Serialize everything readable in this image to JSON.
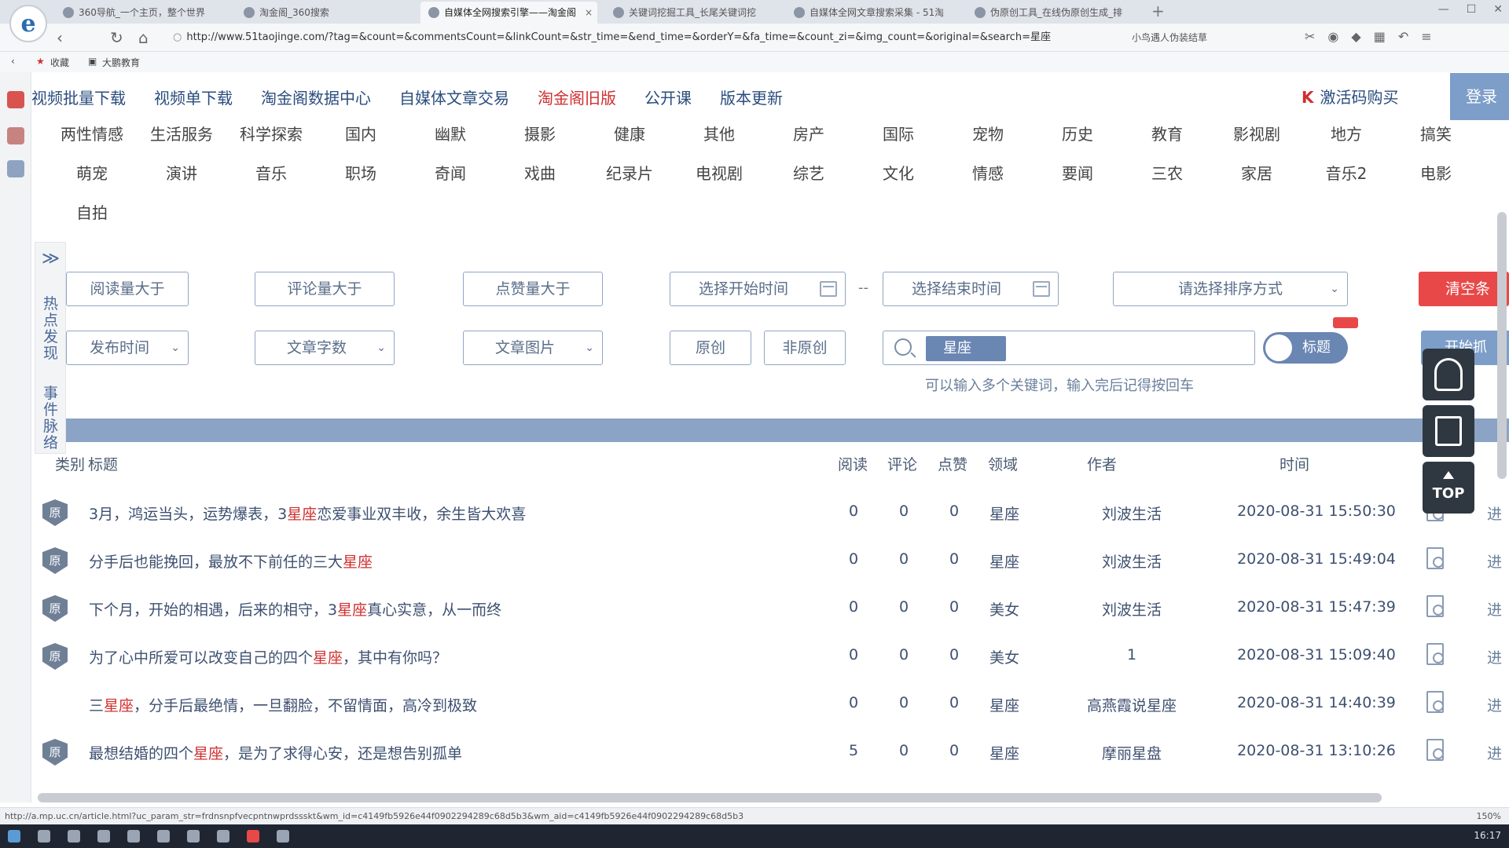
{
  "browser": {
    "tabs": [
      {
        "label": "360导航_一个主页，整个世界"
      },
      {
        "label": "淘金阁_360搜索"
      },
      {
        "label": "自媒体全网搜索引擎——淘金阁"
      },
      {
        "label": "关键词挖掘工具_长尾关键词挖"
      },
      {
        "label": "自媒体全网文章搜索采集 - 51淘"
      },
      {
        "label": "伪原创工具_在线伪原创生成_排"
      }
    ],
    "close_glyph": "×",
    "new_tab_glyph": "+",
    "url": "http://www.51taojinge.com/?tag=&count=&commentsCount=&linkCount=&str_time=&end_time=&orderY=&fa_time=&count_zi=&img_count=&original=&search=星座",
    "search_text": "小鸟遇人伪装结草",
    "bookmarks": [
      "收藏",
      "大鹏教育"
    ],
    "status_url": "http://a.mp.uc.cn/article.html?uc_param_str=frdnsnpfvecpntnwprdssskt&wm_id=c4149fb5926e44f0902294289c68d5b3&wm_aid=c4149fb5926e44f0902294289c68d5b3",
    "zoom": "150%",
    "clock": "16:17"
  },
  "topnav": [
    "视频批量下载",
    "视频单下载",
    "淘金阁数据中心",
    "自媒体文章交易",
    "淘金阁旧版",
    "公开课",
    "版本更新"
  ],
  "activate": {
    "k": "K",
    "label": "激活码购买"
  },
  "login": "登录",
  "categories": [
    [
      "两性情感",
      "生活服务",
      "科学探索",
      "国内",
      "幽默",
      "摄影",
      "健康",
      "其他",
      "房产",
      "国际",
      "宠物",
      "历史",
      "教育",
      "影视剧",
      "地方",
      "搞笑"
    ],
    [
      "萌宠",
      "演讲",
      "音乐",
      "职场",
      "奇闻",
      "戏曲",
      "纪录片",
      "电视剧",
      "综艺",
      "文化",
      "情感",
      "要闻",
      "三农",
      "家居",
      "音乐2",
      "电影"
    ],
    [
      "自拍"
    ]
  ],
  "side_panel": {
    "arrow": "≫",
    "tab1": [
      "热",
      "点",
      "发",
      "现"
    ],
    "tab2": [
      "事",
      "件",
      "脉",
      "络"
    ]
  },
  "filters": {
    "read_gt": "阅读量大于",
    "comment_gt": "评论量大于",
    "like_gt": "点赞量大于",
    "start_time": "选择开始时间",
    "dash": "--",
    "end_time": "选择结束时间",
    "sort": "请选择排序方式",
    "clear": "清空条",
    "publish_time": "发布时间",
    "word_count": "文章字数",
    "images": "文章图片",
    "original": "原创",
    "non_original": "非原创",
    "keyword_tag": "星座",
    "title_toggle": "标题",
    "start_btn": "开始抓",
    "hint": "可以输入多个关键词，输入完后记得按回车"
  },
  "table": {
    "headers": {
      "type": "类别",
      "title": "标题",
      "read": "阅读",
      "comment": "评论",
      "like": "点赞",
      "field": "领域",
      "author": "作者",
      "time": "时间"
    },
    "original_badge": "原",
    "go_label": "进",
    "rows": [
      {
        "badge": true,
        "pre": "3月，鸿运当头，运势爆表，3",
        "kw": "星座",
        "post": "恋爱事业双丰收，余生皆大欢喜",
        "read": "0",
        "comment": "0",
        "like": "0",
        "field": "星座",
        "author": "刘波生活",
        "time": "2020-08-31 15:50:30"
      },
      {
        "badge": true,
        "pre": "分手后也能挽回，最放不下前任的三大",
        "kw": "星座",
        "post": "",
        "read": "0",
        "comment": "0",
        "like": "0",
        "field": "星座",
        "author": "刘波生活",
        "time": "2020-08-31 15:49:04"
      },
      {
        "badge": true,
        "pre": "下个月，开始的相遇，后来的相守，3",
        "kw": "星座",
        "post": "真心实意，从一而终",
        "read": "0",
        "comment": "0",
        "like": "0",
        "field": "美女",
        "author": "刘波生活",
        "time": "2020-08-31 15:47:39"
      },
      {
        "badge": true,
        "pre": "为了心中所爱可以改变自己的四个",
        "kw": "星座",
        "post": "，其中有你吗？",
        "read": "0",
        "comment": "0",
        "like": "0",
        "field": "美女",
        "author": "1",
        "time": "2020-08-31 15:09:40"
      },
      {
        "badge": false,
        "pre": "三",
        "kw": "星座",
        "post": "，分手后最绝情，一旦翻脸，不留情面，高冷到极致",
        "read": "0",
        "comment": "0",
        "like": "0",
        "field": "星座",
        "author": "高燕霞说星座",
        "time": "2020-08-31 14:40:39"
      },
      {
        "badge": true,
        "pre": "最想结婚的四个",
        "kw": "星座",
        "post": "，是为了求得心安，还是想告别孤单",
        "read": "5",
        "comment": "0",
        "like": "0",
        "field": "星座",
        "author": "摩丽星盘",
        "time": "2020-08-31 13:10:26"
      }
    ]
  },
  "float_widgets": {
    "top_label": "TOP"
  },
  "colors": {
    "accent": "#7d9ec9",
    "danger": "#e84848",
    "keyword": "#d0302f",
    "nav_text": "#2b4d7e"
  }
}
